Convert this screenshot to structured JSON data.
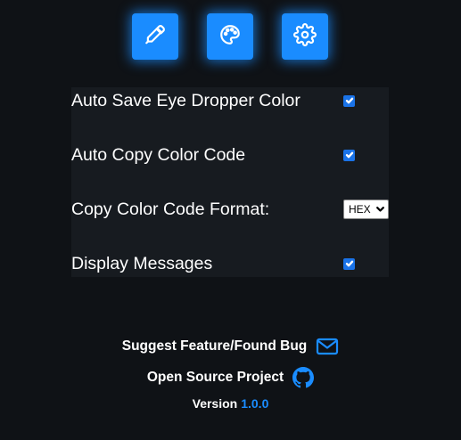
{
  "toolbar": {
    "buttons": [
      {
        "icon": "eyedropper-icon",
        "name": "eyedropper-button"
      },
      {
        "icon": "palette-icon",
        "name": "palette-button"
      },
      {
        "icon": "gear-icon",
        "name": "settings-button"
      }
    ],
    "accent_color": "#1a8cff"
  },
  "settings": {
    "auto_save": {
      "label": "Auto Save Eye Dropper Color",
      "checked": true
    },
    "auto_copy": {
      "label": "Auto Copy Color Code",
      "checked": true
    },
    "format": {
      "label": "Copy Color Code Format:",
      "selected": "HEX"
    },
    "display_messages": {
      "label": "Display Messages",
      "checked": true
    }
  },
  "footer": {
    "suggest_label": "Suggest Feature/Found Bug",
    "suggest_icon": "mail-icon",
    "open_source_label": "Open Source Project",
    "open_source_icon": "github-icon",
    "version_label": "Version",
    "version_number": "1.0.0"
  }
}
